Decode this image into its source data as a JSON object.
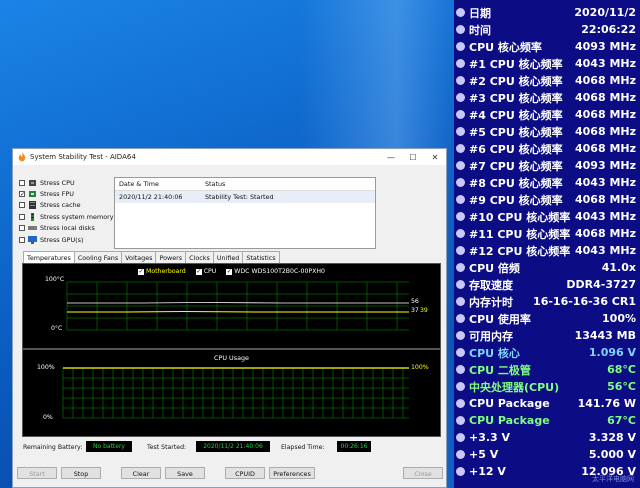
{
  "window": {
    "title": "System Stability Test - AIDA64",
    "min_icon": "minimize-icon",
    "max_icon": "maximize-icon",
    "close_icon": "close-icon"
  },
  "stress": [
    {
      "label": "Stress CPU",
      "checked": false
    },
    {
      "label": "Stress FPU",
      "checked": true
    },
    {
      "label": "Stress cache",
      "checked": false
    },
    {
      "label": "Stress system memory",
      "checked": false
    },
    {
      "label": "Stress local disks",
      "checked": false
    },
    {
      "label": "Stress GPU(s)",
      "checked": false
    }
  ],
  "log": {
    "col_date": "Date & Time",
    "col_status": "Status",
    "rows": [
      {
        "date": "2020/11/2 21:40:06",
        "status": "Stability Test: Started"
      }
    ]
  },
  "tabs": [
    "Temperatures",
    "Cooling Fans",
    "Voltages",
    "Powers",
    "Clocks",
    "Unified",
    "Statistics"
  ],
  "temp_graph": {
    "legend": [
      "Motherboard",
      "CPU",
      "WDC WDS100T2B0C-00PXH0"
    ],
    "y_top": "100°C",
    "y_bottom": "0°C",
    "val1": "56",
    "val2": "37",
    "val3": "39",
    "colors": {
      "motherboard": "#ffffff",
      "cpu": "#ffff00",
      "disk": "#ffffff"
    }
  },
  "usage_graph": {
    "title": "CPU Usage",
    "y_top": "100%",
    "y_bottom": "0%",
    "right_value": "100%",
    "color": "#ffff00",
    "grid_color": "#00a000"
  },
  "status": {
    "battery_label": "Remaining Battery:",
    "battery_value": "No battery",
    "started_label": "Test Started:",
    "started_value": "2020/11/2 21:40:06",
    "elapsed_label": "Elapsed Time:",
    "elapsed_value": "00:26:16"
  },
  "buttons": {
    "start": "Start",
    "stop": "Stop",
    "clear": "Clear",
    "save": "Save",
    "cpuid": "CPUID",
    "preferences": "Preferences",
    "close": "Close"
  },
  "osd": {
    "rows": [
      {
        "label": "日期",
        "value": "2020/11/2",
        "color": "#ffffff"
      },
      {
        "label": "时间",
        "value": "22:06:22",
        "color": "#ffffff"
      },
      {
        "label": "CPU 核心频率",
        "value": "4093 MHz",
        "color": "#ffffff"
      },
      {
        "label": "#1 CPU 核心频率",
        "value": "4043 MHz",
        "color": "#ffffff"
      },
      {
        "label": "#2 CPU 核心频率",
        "value": "4068 MHz",
        "color": "#ffffff"
      },
      {
        "label": "#3 CPU 核心频率",
        "value": "4068 MHz",
        "color": "#ffffff"
      },
      {
        "label": "#4 CPU 核心频率",
        "value": "4068 MHz",
        "color": "#ffffff"
      },
      {
        "label": "#5 CPU 核心频率",
        "value": "4068 MHz",
        "color": "#ffffff"
      },
      {
        "label": "#6 CPU 核心频率",
        "value": "4068 MHz",
        "color": "#ffffff"
      },
      {
        "label": "#7 CPU 核心频率",
        "value": "4093 MHz",
        "color": "#ffffff"
      },
      {
        "label": "#8 CPU 核心频率",
        "value": "4043 MHz",
        "color": "#ffffff"
      },
      {
        "label": "#9 CPU 核心频率",
        "value": "4068 MHz",
        "color": "#ffffff"
      },
      {
        "label": "#10 CPU 核心频率",
        "value": "4043 MHz",
        "color": "#ffffff"
      },
      {
        "label": "#11 CPU 核心频率",
        "value": "4068 MHz",
        "color": "#ffffff"
      },
      {
        "label": "#12 CPU 核心频率",
        "value": "4043 MHz",
        "color": "#ffffff"
      },
      {
        "label": "CPU 倍频",
        "value": "41.0x",
        "color": "#ffffff"
      },
      {
        "label": "存取速度",
        "value": "DDR4-3727",
        "color": "#ffffff"
      },
      {
        "label": "内存计时",
        "value": "16-16-16-36 CR1",
        "color": "#ffffff"
      },
      {
        "label": "CPU 使用率",
        "value": "100%",
        "color": "#ffffff"
      },
      {
        "label": "可用内存",
        "value": "13443 MB",
        "color": "#ffffff"
      },
      {
        "label": "CPU 核心",
        "value": "1.096 V",
        "color": "#7fd4ff"
      },
      {
        "label": "CPU 二极管",
        "value": "68°C",
        "color": "#7fff7f"
      },
      {
        "label": "中央处理器(CPU)",
        "value": "56°C",
        "color": "#7fff7f"
      },
      {
        "label": "CPU Package",
        "value": "141.76 W",
        "color": "#ffffff"
      },
      {
        "label": "CPU Package",
        "value": "67°C",
        "color": "#7fff7f"
      },
      {
        "label": "+3.3 V",
        "value": "3.328 V",
        "color": "#ffffff"
      },
      {
        "label": "+5 V",
        "value": "5.000 V",
        "color": "#ffffff"
      },
      {
        "label": "+12 V",
        "value": "12.096 V",
        "color": "#ffffff"
      }
    ],
    "watermark": "太平洋电脑网"
  }
}
